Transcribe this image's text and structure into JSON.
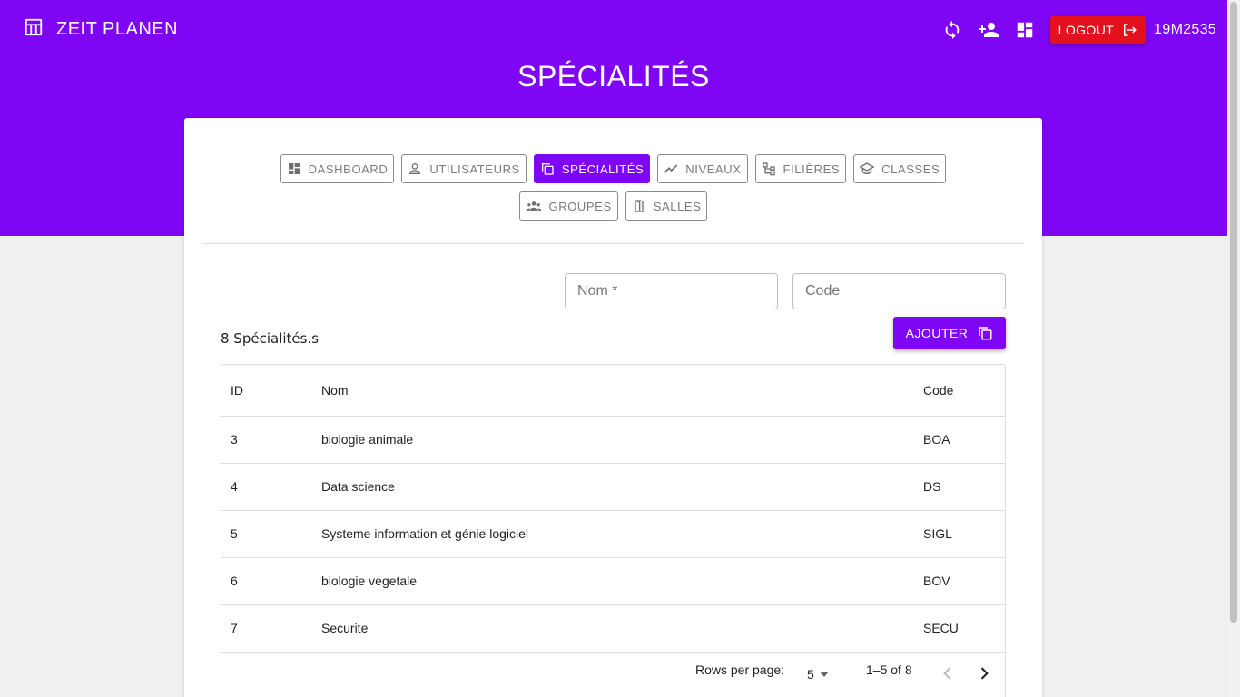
{
  "app": {
    "brand": "ZEIT PLANEN",
    "user_code": "19M2535",
    "logout_label": "LOGOUT",
    "accent_color": "#7f06f5",
    "logout_color": "#e3101d"
  },
  "page": {
    "title": "SPÉCIALITÉS"
  },
  "nav": {
    "items": [
      {
        "label": "DASHBOARD",
        "icon": "dashboard-icon"
      },
      {
        "label": "UTILISATEURS",
        "icon": "person-icon"
      },
      {
        "label": "SPÉCIALITÉS",
        "icon": "copy-icon",
        "active": true
      },
      {
        "label": "NIVEAUX",
        "icon": "trend-icon"
      },
      {
        "label": "FILIÈRES",
        "icon": "tree-icon"
      },
      {
        "label": "CLASSES",
        "icon": "school-icon"
      },
      {
        "label": "GROUPES",
        "icon": "groups-icon"
      },
      {
        "label": "SALLES",
        "icon": "door-icon"
      }
    ]
  },
  "form": {
    "nom_placeholder": "Nom *",
    "code_placeholder": "Code",
    "add_label": "AJOUTER"
  },
  "list": {
    "count_label": "8 Spécialités.s",
    "headers": {
      "id": "ID",
      "nom": "Nom",
      "code": "Code"
    },
    "rows": [
      {
        "id": "3",
        "nom": "biologie animale",
        "code": "BOA"
      },
      {
        "id": "4",
        "nom": "Data science",
        "code": "DS"
      },
      {
        "id": "5",
        "nom": "Systeme information et génie logiciel",
        "code": "SIGL"
      },
      {
        "id": "6",
        "nom": "biologie vegetale",
        "code": "BOV"
      },
      {
        "id": "7",
        "nom": "Securite",
        "code": "SECU"
      }
    ]
  },
  "pagination": {
    "rows_per_page_label": "Rows per page:",
    "rows_per_page": "5",
    "range": "1–5 of 8"
  }
}
